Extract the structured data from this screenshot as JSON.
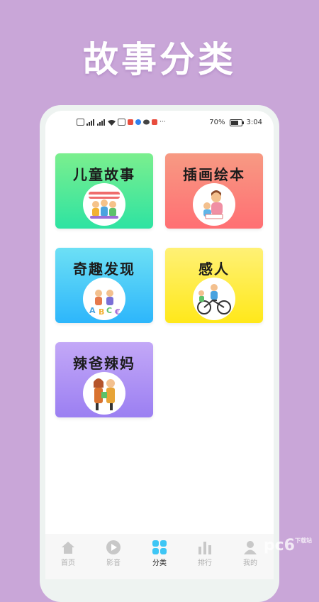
{
  "promo_title": "故事分类",
  "status_bar": {
    "battery": "70%",
    "time": "3:04",
    "battery_level": 0.7
  },
  "categories": [
    {
      "label": "儿童故事",
      "icon": "kids-group-icon"
    },
    {
      "label": "插画绘本",
      "icon": "mother-reading-icon"
    },
    {
      "label": "奇趣发现",
      "icon": "abc-kids-icon"
    },
    {
      "label": "感人",
      "icon": "family-bicycle-icon"
    },
    {
      "label": "辣爸辣妈",
      "icon": "parents-shopping-icon"
    }
  ],
  "tabs": [
    {
      "label": "首页",
      "icon": "home-icon",
      "active": false
    },
    {
      "label": "影音",
      "icon": "play-icon",
      "active": false
    },
    {
      "label": "分类",
      "icon": "grid-icon",
      "active": true
    },
    {
      "label": "排行",
      "icon": "bar-chart-icon",
      "active": false
    },
    {
      "label": "我的",
      "icon": "user-icon",
      "active": false
    }
  ],
  "colors": {
    "background": "#c9a6d8",
    "accent": "#3ec6f5"
  }
}
